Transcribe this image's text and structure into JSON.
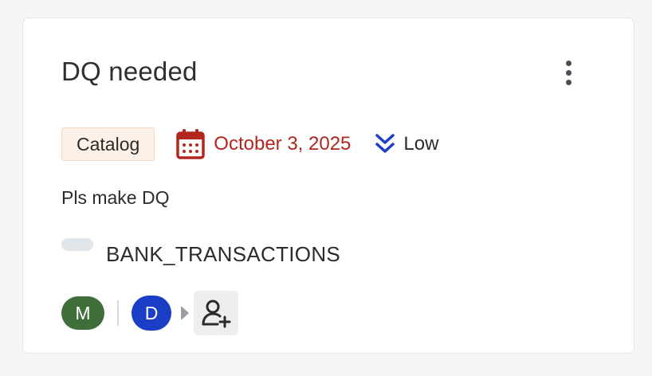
{
  "card": {
    "title": "DQ needed",
    "menu_icon": "more-vertical-icon"
  },
  "meta": {
    "tag": "Catalog",
    "date": "October 3, 2025",
    "date_icon": "calendar-icon",
    "date_color": "#b3261e",
    "priority": "Low",
    "priority_icon": "chevrons-down-icon",
    "priority_color": "#1b3ec7"
  },
  "description": "Pls make DQ",
  "asset": {
    "name": "BANK_TRANSACTIONS"
  },
  "people": {
    "assignee_initial": "M",
    "assignee_color": "#3f6e3b",
    "reviewer_initial": "D",
    "reviewer_color": "#1b3ec7",
    "add_icon": "user-plus-icon"
  }
}
